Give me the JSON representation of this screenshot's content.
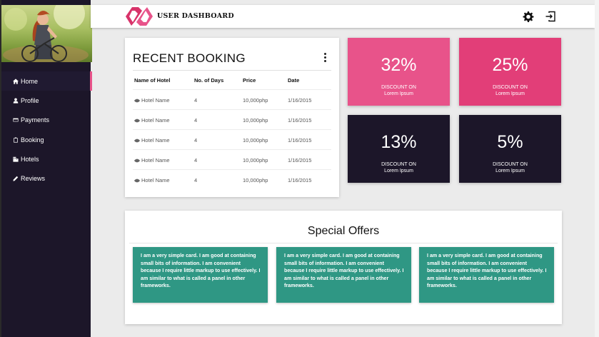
{
  "app": {
    "title": "USER DASHBOARD"
  },
  "sidebar": {
    "items": [
      {
        "label": "Home",
        "icon": "home-icon",
        "active": true
      },
      {
        "label": "Profile",
        "icon": "person-icon"
      },
      {
        "label": "Payments",
        "icon": "credit-card-icon"
      },
      {
        "label": "Booking",
        "icon": "clipboard-icon"
      },
      {
        "label": "Hotels",
        "icon": "building-icon"
      },
      {
        "label": "Reviews",
        "icon": "pencil-icon"
      }
    ]
  },
  "booking": {
    "title": "RECENT BOOKING",
    "columns": [
      "Name of Hotel",
      "No. of Days",
      "Price",
      "Date"
    ],
    "rows": [
      {
        "name": "Hotel Name",
        "days": "4",
        "price": "10,000php",
        "date": "1/16/2015"
      },
      {
        "name": "Hotel Name",
        "days": "4",
        "price": "10,000php",
        "date": "1/16/2015"
      },
      {
        "name": "Hotel Name",
        "days": "4",
        "price": "10,000php",
        "date": "1/16/2015"
      },
      {
        "name": "Hotel Name",
        "days": "4",
        "price": "10,000php",
        "date": "1/16/2015"
      },
      {
        "name": "Hotel Name",
        "days": "4",
        "price": "10,000php",
        "date": "1/16/2015"
      }
    ]
  },
  "discounts": [
    {
      "percent": "32%",
      "line1": "DISCOUNT ON",
      "line2": "Lorem Ipsum",
      "color": "#e8538a"
    },
    {
      "percent": "25%",
      "line1": "DISCOUNT ON",
      "line2": "Lorem Ipsum",
      "color": "#e23e78"
    },
    {
      "percent": "13%",
      "line1": "DISCOUNT ON",
      "line2": "Lorem Ipsum",
      "color": "#1c1629"
    },
    {
      "percent": "5%",
      "line1": "DISCOUNT ON",
      "line2": "Lorem Ipsum",
      "color": "#1c1629"
    }
  ],
  "offers": {
    "title": "Special Offers",
    "cards": [
      {
        "text": "I am a very simple card. I am good at containing small bits of information. I am convenient because I require little markup to use effectively. I am similar to what is called a panel in other frameworks."
      },
      {
        "text": "I am a very simple card. I am good at containing small bits of information. I am convenient because I require little markup to use effectively. I am similar to what is called a panel in other frameworks."
      },
      {
        "text": "I am a very simple card. I am good at containing small bits of information. I am convenient because I require little markup to use effectively. I am similar to what is called a panel in other frameworks."
      }
    ],
    "card_color": "#2f9784"
  },
  "colors": {
    "accent": "#e8538a",
    "sidebar_bg": "#1c1629",
    "offer_bg": "#2f9784"
  },
  "header_icons": [
    "settings-gear-icon",
    "logout-icon"
  ]
}
